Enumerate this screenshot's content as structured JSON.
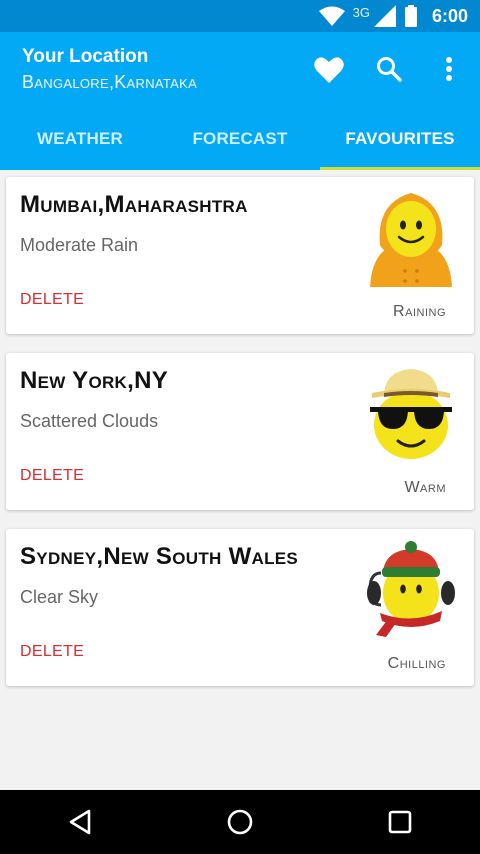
{
  "status_bar": {
    "network": "3G",
    "time": "6:00"
  },
  "header": {
    "title": "Your Location",
    "subtitle": "Bangalore,Karnataka",
    "icons": [
      "heart-icon",
      "search-icon",
      "more-vert-icon"
    ]
  },
  "tabs": [
    {
      "label": "WEATHER",
      "active": false
    },
    {
      "label": "FORECAST",
      "active": false
    },
    {
      "label": "FAVOURITES",
      "active": true
    }
  ],
  "favourites": [
    {
      "city": "Mumbai,Maharashtra",
      "condition": "Moderate Rain",
      "delete_label": "DELETE",
      "mood": "Raining",
      "emoji": "raincoat-emoji"
    },
    {
      "city": "New York,NY",
      "condition": "Scattered Clouds",
      "delete_label": "DELETE",
      "mood": "Warm",
      "emoji": "sunglasses-emoji"
    },
    {
      "city": "Sydney,New South Wales",
      "condition": "Clear Sky",
      "delete_label": "DELETE",
      "mood": "Chilling",
      "emoji": "winter-hat-emoji"
    }
  ],
  "nav": [
    "back-icon",
    "home-icon",
    "recents-icon"
  ],
  "colors": {
    "status_bar": "#0288d1",
    "app_bar": "#03a9f4",
    "tab_indicator": "#cddc39",
    "delete": "#d32f2f"
  }
}
